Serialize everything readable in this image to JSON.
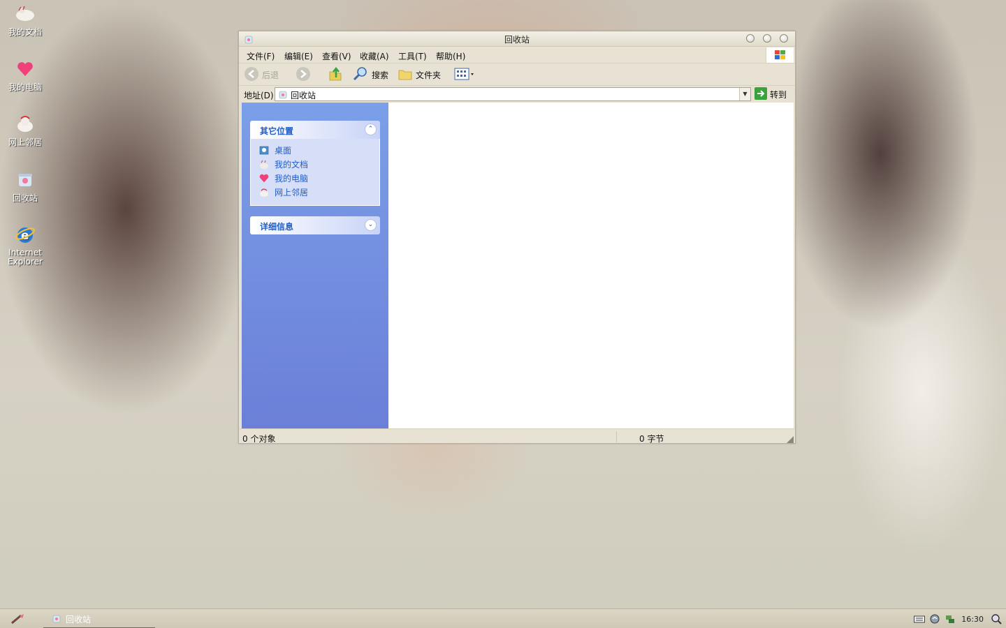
{
  "desktop": {
    "icons": [
      {
        "label": "我的文档"
      },
      {
        "label": "我的电脑"
      },
      {
        "label": "网上邻居"
      },
      {
        "label": "回收站"
      },
      {
        "label": "Internet Explorer"
      }
    ]
  },
  "window": {
    "title": "回收站",
    "menu": [
      "文件(F)",
      "编辑(E)",
      "查看(V)",
      "收藏(A)",
      "工具(T)",
      "帮助(H)"
    ],
    "toolbar": {
      "back": "后退",
      "search": "搜索",
      "folders": "文件夹"
    },
    "address": {
      "label": "地址(D)",
      "value": "回收站",
      "go": "转到"
    },
    "taskpane": {
      "other_places": {
        "title": "其它位置",
        "links": [
          "桌面",
          "我的文档",
          "我的电脑",
          "网上邻居"
        ]
      },
      "details": {
        "title": "详细信息"
      }
    },
    "status": {
      "objects": "0 个对象",
      "size": "0 字节"
    }
  },
  "taskbar": {
    "task_label": "回收站",
    "clock": "16:30"
  },
  "colors": {
    "taskpane_top": "#7b9fe8",
    "taskpane_bottom": "#6b7fd8",
    "link": "#215dc6"
  }
}
